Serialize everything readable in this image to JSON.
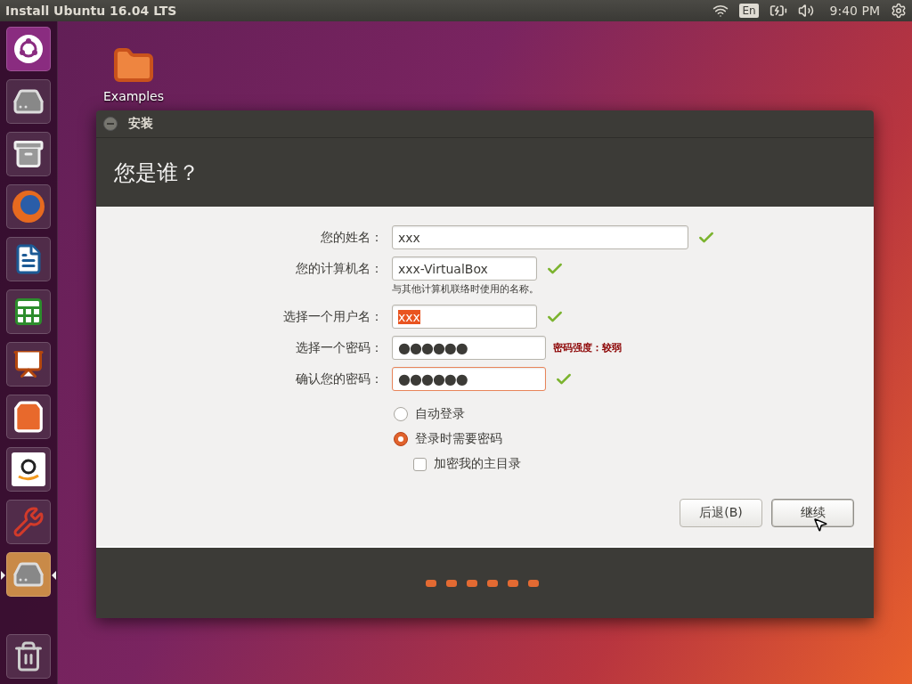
{
  "top_bar": {
    "title": "Install Ubuntu 16.04 LTS",
    "keyboard": "En",
    "time": "9:40 PM"
  },
  "launcher": [
    {
      "kind": "dash",
      "active": false
    },
    {
      "kind": "installer",
      "active": false
    },
    {
      "kind": "files",
      "active": false
    },
    {
      "kind": "browser",
      "active": false
    },
    {
      "kind": "writer",
      "active": false
    },
    {
      "kind": "calc",
      "active": false
    },
    {
      "kind": "impress",
      "active": false
    },
    {
      "kind": "software",
      "active": false
    },
    {
      "kind": "amazon",
      "active": false
    },
    {
      "kind": "settings",
      "active": false
    },
    {
      "kind": "installer",
      "active": true
    },
    {
      "kind": "trash",
      "active": false
    }
  ],
  "desktop_icons": [
    {
      "label": "Examples"
    }
  ],
  "window": {
    "title": "安装",
    "heading": "您是谁？",
    "fields": [
      {
        "label": "您的姓名：",
        "value": "xxx",
        "kind": "text",
        "valid": true,
        "highlighted": false,
        "focused": false
      },
      {
        "label": "您的计算机名：",
        "value": "xxx-VirtualBox",
        "kind": "text",
        "valid": true,
        "highlighted": false,
        "focused": false,
        "hint": "与其他计算机联络时使用的名称。"
      },
      {
        "label": "选择一个用户名：",
        "value": "xxx",
        "kind": "text",
        "valid": true,
        "highlighted": true,
        "focused": false
      },
      {
        "label": "选择一个密码：",
        "value": "●●●●●●",
        "kind": "password",
        "valid": false,
        "focused": false,
        "strength": "密码强度：较弱"
      },
      {
        "label": "确认您的密码：",
        "value": "●●●●●●",
        "kind": "password",
        "valid": true,
        "focused": true
      }
    ],
    "login_options": [
      {
        "label": "自动登录",
        "selected": false
      },
      {
        "label": "登录时需要密码",
        "selected": true
      }
    ],
    "encrypt_home": {
      "label": "加密我的主目录",
      "checked": false
    },
    "buttons": [
      {
        "label": "后退(B)",
        "default": false
      },
      {
        "label": "继续",
        "default": true
      }
    ]
  }
}
